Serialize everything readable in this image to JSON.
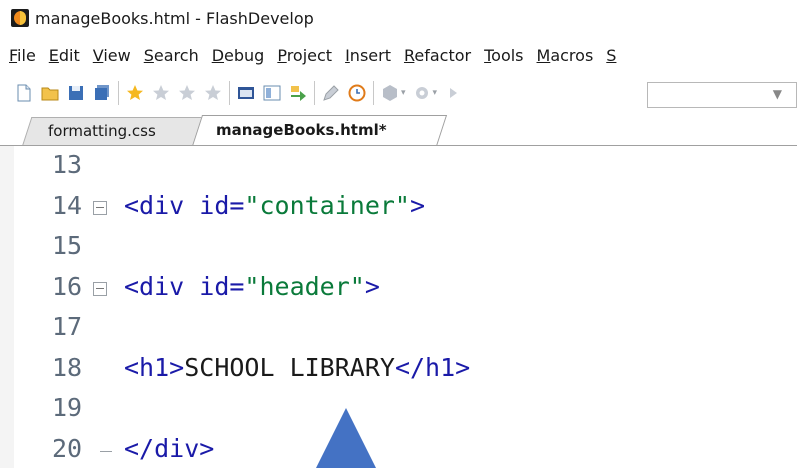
{
  "window": {
    "title": "manageBooks.html - FlashDevelop",
    "app_icon": "flashdevelop-icon"
  },
  "menu": {
    "items": [
      {
        "label": "File",
        "underline": "F",
        "rest": "ile"
      },
      {
        "label": "Edit",
        "underline": "E",
        "rest": "dit"
      },
      {
        "label": "View",
        "underline": "V",
        "rest": "iew"
      },
      {
        "label": "Search",
        "underline": "S",
        "rest": "earch"
      },
      {
        "label": "Debug",
        "underline": "D",
        "rest": "ebug"
      },
      {
        "label": "Project",
        "underline": "P",
        "rest": "roject"
      },
      {
        "label": "Insert",
        "underline": "I",
        "rest": "nsert"
      },
      {
        "label": "Refactor",
        "underline": "R",
        "rest": "efactor"
      },
      {
        "label": "Tools",
        "underline": "T",
        "rest": "ools"
      },
      {
        "label": "Macros",
        "underline": "M",
        "rest": "acros"
      },
      {
        "label": "S",
        "underline": "S",
        "rest": ""
      }
    ]
  },
  "toolbar": {
    "icons": [
      "new-file-icon",
      "open-folder-icon",
      "save-icon",
      "save-all-icon",
      "star-add-icon",
      "star-icon",
      "star-icon",
      "star-icon",
      "panel-icon",
      "panel-alt-icon",
      "arrow-right-icon",
      "pen-icon",
      "clock-icon",
      "build-icon",
      "settings-icon",
      "play-icon"
    ],
    "combo_value": ""
  },
  "tabs": [
    {
      "label": "formatting.css",
      "active": false
    },
    {
      "label": "manageBooks.html*",
      "active": true
    }
  ],
  "editor": {
    "lines": [
      {
        "number": "13",
        "code": []
      },
      {
        "number": "14",
        "fold": "open",
        "code": [
          {
            "t": "<div ",
            "c": "tag"
          },
          {
            "t": "id=",
            "c": "attr"
          },
          {
            "t": "\"container\"",
            "c": "str"
          },
          {
            "t": ">",
            "c": "tag"
          }
        ]
      },
      {
        "number": "15",
        "code": []
      },
      {
        "number": "16",
        "fold": "open",
        "code": [
          {
            "t": "<div ",
            "c": "tag"
          },
          {
            "t": "id=",
            "c": "attr"
          },
          {
            "t": "\"header\"",
            "c": "str"
          },
          {
            "t": ">",
            "c": "tag"
          }
        ]
      },
      {
        "number": "17",
        "code": []
      },
      {
        "number": "18",
        "code": [
          {
            "t": "<h1>",
            "c": "tag"
          },
          {
            "t": "SCHOOL LIBRARY",
            "c": "txt"
          },
          {
            "t": "</h1>",
            "c": "tag"
          }
        ]
      },
      {
        "number": "19",
        "code": []
      },
      {
        "number": "20",
        "fold": "end",
        "code": [
          {
            "t": "</div>",
            "c": "tag"
          }
        ]
      }
    ]
  },
  "colors": {
    "tag": "#1a1aa8",
    "string": "#0a7a3a",
    "text": "#1a1a1a",
    "line_number": "#5c6a7a",
    "annotation_arrow": "#4472c4"
  }
}
